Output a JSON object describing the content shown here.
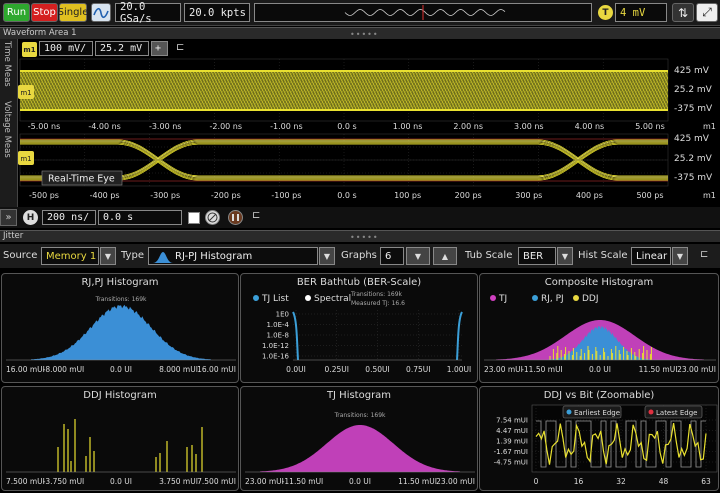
{
  "toolbar": {
    "run": "Run",
    "stop": "Stop",
    "single": "Single",
    "sample_rate": "20.0 GSa/s",
    "points": "20.0 kpts",
    "trigger_badge": "T",
    "trigger_level": "4 mV"
  },
  "waveform_area": {
    "header": "Waveform Area 1",
    "tab_time": "Time Meas",
    "tab_voltage": "Voltage Meas",
    "m1_label": "m1",
    "v_scale": "100 mV/",
    "v_offset": "25.2 mV",
    "top_right_labels": [
      "425 mV",
      "25.2 mV",
      "-375 mV"
    ],
    "top_time_ticks": [
      "-5.00 ns",
      "-4.00 ns",
      "-3.00 ns",
      "-2.00 ns",
      "-1.00 ns",
      "0.0 s",
      "1.00 ns",
      "2.00 ns",
      "3.00 ns",
      "4.00 ns",
      "5.00 ns"
    ],
    "bottom_right_labels": [
      "425 mV",
      "25.2 mV",
      "-375 mV"
    ],
    "bottom_time_ticks": [
      "-500 ps",
      "-400 ps",
      "-300 ps",
      "-200 ps",
      "-100 ps",
      "0.0 s",
      "100 ps",
      "200 ps",
      "300 ps",
      "400 ps",
      "500 ps"
    ],
    "m1_tick_label": "m1",
    "eye_label": "Real-Time Eye",
    "h_badge": "H",
    "h_scale": "200 ns/",
    "h_position": "0.0 s"
  },
  "jitter": {
    "header": "Jitter",
    "source_label": "Source",
    "source_value": "Memory 1",
    "type_label": "Type",
    "type_value": "RJ-PJ Histogram",
    "graphs_label": "Graphs",
    "graphs_value": "6",
    "tub_label": "Tub Scale",
    "tub_value": "BER",
    "hist_label": "Hist Scale",
    "hist_value": "Linear",
    "panels": {
      "rjpj": {
        "title": "RJ,PJ Histogram",
        "note": "Transitions: 169k",
        "ticks": [
          "16.00 mUI",
          "-8.000 mUI",
          "0.0 UI",
          "8.000 mUI",
          "16.00 mUI"
        ]
      },
      "bathtub": {
        "title": "BER Bathtub (BER-Scale)",
        "legend_a": "TJ List",
        "legend_b": "Spectral",
        "note1": "Transitions: 169k",
        "note2": "Measured TJ: 16.6",
        "y_ticks": [
          "1E0",
          "1.0E-4",
          "1.0E-8",
          "1.0E-12",
          "1.0E-16"
        ],
        "x_ticks": [
          "0.0UI",
          "0.25UI",
          "0.50UI",
          "0.75UI",
          "1.00UI"
        ]
      },
      "composite": {
        "title": "Composite Histogram",
        "legend_a": "TJ",
        "legend_b": "RJ, PJ",
        "legend_c": "DDJ",
        "ticks": [
          "23.00 mUI",
          "-11.50 mUI",
          "0.0 UI",
          "11.50 mUI",
          "23.00 mUI"
        ]
      },
      "ddj": {
        "title": "DDJ Histogram",
        "ticks": [
          "7.500 mUI",
          "-3.750 mUI",
          "0.0 UI",
          "3.750 mUI",
          "7.500 mUI"
        ]
      },
      "tj": {
        "title": "TJ Histogram",
        "note": "Transitions: 169k",
        "ticks": [
          "23.00 mUI",
          "-11.50 mUI",
          "0.0 UI",
          "11.50 mUI",
          "23.00 mUI"
        ]
      },
      "ddjbit": {
        "title": "DDJ vs Bit (Zoomable)",
        "legend_a": "Earliest Edge",
        "legend_b": "Latest Edge",
        "y_ticks": [
          "7.54 mUI",
          "4.47 mUI",
          "1.39 mUI",
          "-1.67 mUI",
          "-4.75 mUI"
        ],
        "x_ticks": [
          "0",
          "16",
          "32",
          "48",
          "63"
        ]
      }
    }
  },
  "colors": {
    "ch1": "#e8e030",
    "accent": "#3b8fd6",
    "magenta": "#d040c0"
  }
}
